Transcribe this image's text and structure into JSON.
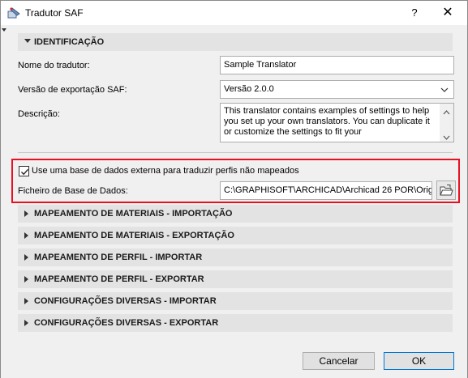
{
  "window": {
    "title": "Tradutor SAF",
    "help_glyph": "?",
    "close_glyph": "✕"
  },
  "identificacao": {
    "header": "IDENTIFICAÇÃO",
    "translator_name_label": "Nome do tradutor:",
    "translator_name_value": "Sample Translator",
    "export_version_label": "Versão de exportação SAF:",
    "export_version_value": "Versão 2.0.0",
    "description_label": "Descrição:",
    "description_value": "This translator contains examples of settings to help you set up your own translators. You can duplicate it or customize the settings to fit your"
  },
  "external_db": {
    "checkbox_label": "Use uma base de dados externa para traduzir perfis não mapeados",
    "checked": true,
    "file_label": "Ficheiro de Base de Dados:",
    "file_path": "C:\\GRAPHISOFT\\ARCHICAD\\Archicad 26 POR\\Orig"
  },
  "sections": [
    "MAPEAMENTO DE MATERIAIS - IMPORTAÇÃO",
    "MAPEAMENTO DE MATERIAIS - EXPORTAÇÃO",
    "MAPEAMENTO DE PERFIL - IMPORTAR",
    "MAPEAMENTO DE PERFIL - EXPORTAR",
    "CONFIGURAÇÕES DIVERSAS - IMPORTAR",
    "CONFIGURAÇÕES DIVERSAS - EXPORTAR"
  ],
  "buttons": {
    "cancel": "Cancelar",
    "ok": "OK"
  },
  "colors": {
    "highlight": "#e81123",
    "section_bg": "#e3e3e3",
    "ok_border": "#0078d7"
  }
}
